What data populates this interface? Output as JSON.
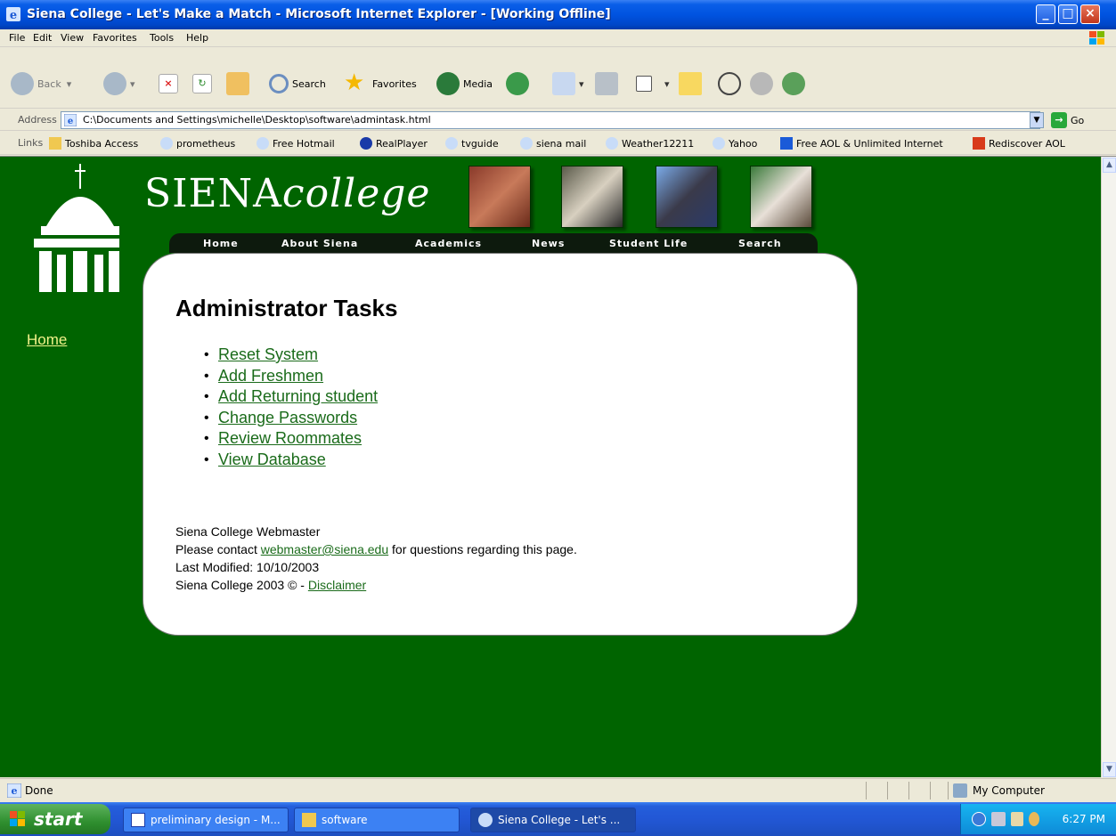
{
  "window": {
    "title": "Siena College - Let's Make a Match - Microsoft Internet Explorer - [Working Offline]"
  },
  "menu": [
    "File",
    "Edit",
    "View",
    "Favorites",
    "Tools",
    "Help"
  ],
  "toolbar": {
    "back": "Back",
    "search": "Search",
    "favorites": "Favorites",
    "media": "Media"
  },
  "address": {
    "label": "Address",
    "value": "C:\\Documents and Settings\\michelle\\Desktop\\software\\admintask.html",
    "go": "Go"
  },
  "links": {
    "label": "Links",
    "items": [
      "Toshiba Access",
      "prometheus",
      "Free Hotmail",
      "RealPlayer",
      "tvguide",
      "siena mail",
      "Weather12211",
      "Yahoo",
      "Free AOL & Unlimited Internet",
      "Rediscover AOL"
    ]
  },
  "site": {
    "logo_main": "SIENA",
    "logo_sub": "college",
    "nav": [
      "Home",
      "About Siena",
      "Academics",
      "News",
      "Student Life",
      "Search"
    ],
    "side_home": "Home"
  },
  "page": {
    "heading": "Administrator Tasks",
    "tasks": [
      "Reset System",
      "Add Freshmen",
      "Add Returning student",
      "Change Passwords",
      "Review Roommates",
      "View Database"
    ],
    "footer": {
      "line1": "Siena College Webmaster",
      "line2_pre": "Please contact ",
      "email": "webmaster@siena.edu",
      "line2_post": " for questions regarding this page.",
      "line3": "Last Modified: 10/10/2003",
      "line4_pre": "Siena College 2003 © - ",
      "disclaimer": "Disclaimer"
    }
  },
  "status": {
    "text": "Done",
    "zone": "My Computer"
  },
  "taskbar": {
    "start": "start",
    "buttons": [
      "preliminary design - M...",
      "software",
      "Siena College - Let's ..."
    ],
    "time": "6:27 PM"
  },
  "colors": {
    "page_bg": "#006400",
    "link": "#1a6b1a",
    "side_link": "#f2f28a"
  }
}
